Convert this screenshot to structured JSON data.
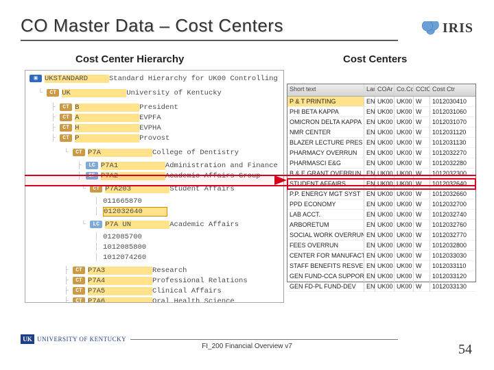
{
  "title": "CO Master Data – Cost Centers",
  "logo_text": "IRIS",
  "subheading_left": "Cost Center Hierarchy",
  "subheading_right": "Cost Centers",
  "hierarchy": {
    "root": {
      "code": "UKSTANDARD",
      "desc": "Standard Hierarchy for UK00 Controlling"
    },
    "uk": {
      "code": "UK",
      "desc": "University of Kentucky"
    },
    "groups1": [
      {
        "code": "B",
        "desc": "President"
      },
      {
        "code": "A",
        "desc": "EVPFA"
      },
      {
        "code": "H",
        "desc": "EVPHA"
      },
      {
        "code": "P",
        "desc": "Provost"
      }
    ],
    "p7a": {
      "code": "P7A",
      "desc": "College of Dentistry"
    },
    "p7a_children": [
      {
        "badge": "LC",
        "code": "P7A1",
        "desc": "Administration and Finance"
      },
      {
        "badge": "SF",
        "code": "P7A2",
        "desc": "Academic Affairs Group"
      }
    ],
    "p7a203": {
      "code": "P7A203",
      "desc": "Student Affairs"
    },
    "p7a203_leaves": [
      "011665870",
      "012032640"
    ],
    "p7a_un": {
      "code": "P7A UN",
      "desc": "Academic Affairs"
    },
    "p7a_un_leaves": [
      "012085700",
      "1012085800",
      "1012074260"
    ],
    "groups2": [
      {
        "code": "P7A3",
        "desc": "Research"
      },
      {
        "code": "P7A4",
        "desc": "Professional Relations"
      },
      {
        "code": "P7A5",
        "desc": "Clinical Affairs"
      },
      {
        "code": "P7A6",
        "desc": "Oral Health Science"
      },
      {
        "code": "P7A7",
        "desc": "Oral Health Practice"
      }
    ]
  },
  "table": {
    "headers": {
      "c1": "Short text",
      "c2": "Language",
      "c3": "COAr",
      "c4": "Co.Cd",
      "c5": "CCtC",
      "c6": "Cost Ctr"
    },
    "rows": [
      {
        "name": "P & T PRINTING",
        "lang": "EN",
        "coar": "UK00",
        "cocd": "UK00",
        "cctc": "W",
        "ctr": "1012030410",
        "hl": true
      },
      {
        "name": "PHI BETA KAPPA",
        "lang": "EN",
        "coar": "UK00",
        "cocd": "UK00",
        "cctc": "W",
        "ctr": "1012031060"
      },
      {
        "name": "OMICRON DELTA KAPPA",
        "lang": "EN",
        "coar": "UK00",
        "cocd": "UK00",
        "cctc": "W",
        "ctr": "1012031070"
      },
      {
        "name": "NMR CENTER",
        "lang": "EN",
        "coar": "UK00",
        "cocd": "UK00",
        "cctc": "W",
        "ctr": "1012031120"
      },
      {
        "name": "BLAZER LECTURE PRES",
        "lang": "EN",
        "coar": "UK00",
        "cocd": "UK00",
        "cctc": "W",
        "ctr": "1012031130"
      },
      {
        "name": "PHARMACY OVERRUN",
        "lang": "EN",
        "coar": "UK00",
        "cocd": "UK00",
        "cctc": "W",
        "ctr": "1012032270"
      },
      {
        "name": "PHARMASCI E&G",
        "lang": "EN",
        "coar": "UK00",
        "cocd": "UK00",
        "cctc": "W",
        "ctr": "1012032280"
      },
      {
        "name": "B & E GRANT OVERRUN",
        "lang": "EN",
        "coar": "UK00",
        "cocd": "UK00",
        "cctc": "W",
        "ctr": "1012032300"
      },
      {
        "name": "STUDENT AFFAIRS",
        "lang": "EN",
        "coar": "UK00",
        "cocd": "UK00",
        "cctc": "W",
        "ctr": "1012032640",
        "highlight": true
      },
      {
        "name": "P.P. ENERGY MGT SYST",
        "lang": "EN",
        "coar": "UK00",
        "cocd": "UK00",
        "cctc": "W",
        "ctr": "1012032660"
      },
      {
        "name": "PPD ECONOMY",
        "lang": "EN",
        "coar": "UK00",
        "cocd": "UK00",
        "cctc": "W",
        "ctr": "1012032700"
      },
      {
        "name": "LAB ACCT.",
        "lang": "EN",
        "coar": "UK00",
        "cocd": "UK00",
        "cctc": "W",
        "ctr": "1012032740"
      },
      {
        "name": "ARBORETUM",
        "lang": "EN",
        "coar": "UK00",
        "cocd": "UK00",
        "cctc": "W",
        "ctr": "1012032760"
      },
      {
        "name": "SOCIAL WORK OVERRUN",
        "lang": "EN",
        "coar": "UK00",
        "cocd": "UK00",
        "cctc": "W",
        "ctr": "1012032770"
      },
      {
        "name": "FEES OVERRUN",
        "lang": "EN",
        "coar": "UK00",
        "cocd": "UK00",
        "cctc": "W",
        "ctr": "1012032800"
      },
      {
        "name": "CENTER FOR MANUFACTR",
        "lang": "EN",
        "coar": "UK00",
        "cocd": "UK00",
        "cctc": "W",
        "ctr": "1012033030"
      },
      {
        "name": "STAFF BENEFITS RESVE",
        "lang": "EN",
        "coar": "UK00",
        "cocd": "UK00",
        "cctc": "W",
        "ctr": "1012033110"
      },
      {
        "name": "GEN FUND-CCA SUPPORT",
        "lang": "EN",
        "coar": "UK00",
        "cocd": "UK00",
        "cctc": "W",
        "ctr": "1012033120"
      },
      {
        "name": "GEN FD-PL FUND-DEV",
        "lang": "EN",
        "coar": "UK00",
        "cocd": "UK00",
        "cctc": "W",
        "ctr": "1012033130"
      }
    ]
  },
  "footer": {
    "uk_text": "UNIVERSITY OF KENTUCKY",
    "center": "FI_200 Financial Overview v7",
    "page": "54"
  }
}
